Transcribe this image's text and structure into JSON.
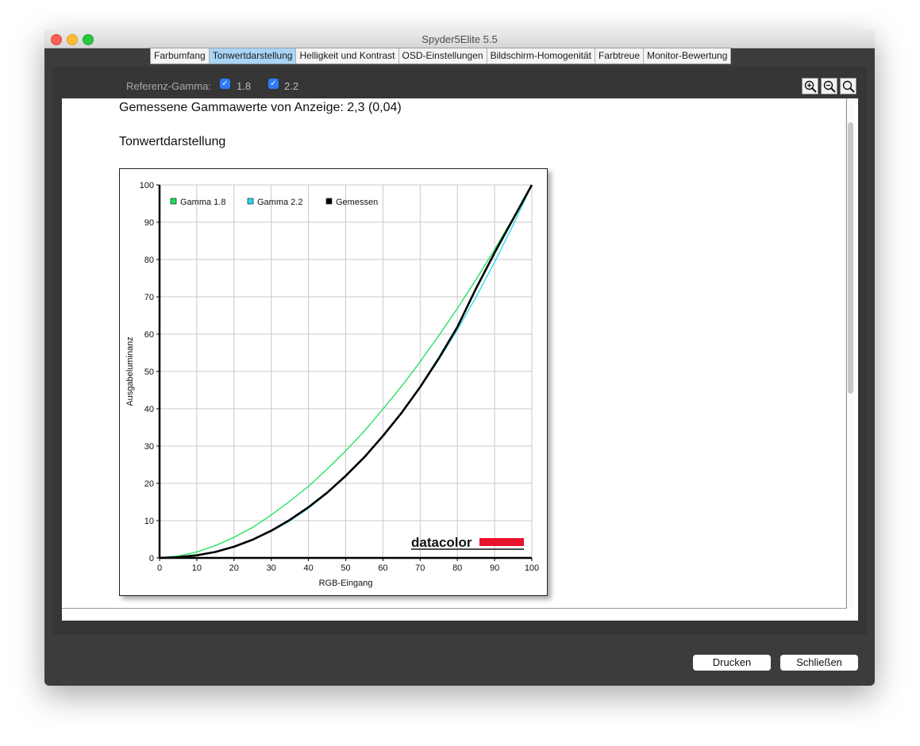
{
  "window": {
    "title": "Spyder5Elite 5.5"
  },
  "tabs": [
    {
      "label": "Farbumfang",
      "active": false
    },
    {
      "label": "Tonwertdarstellung",
      "active": true
    },
    {
      "label": "Helligkeit und Kontrast",
      "active": false
    },
    {
      "label": "OSD-Einstellungen",
      "active": false
    },
    {
      "label": "Bildschirm-Homogenität",
      "active": false
    },
    {
      "label": "Farbtreue",
      "active": false
    },
    {
      "label": "Monitor-Bewertung",
      "active": false
    }
  ],
  "toolbar": {
    "ref_gamma_label": "Referenz-Gamma:",
    "gamma_options": [
      {
        "label": "1.8",
        "checked": true
      },
      {
        "label": "2.2",
        "checked": true
      }
    ],
    "zoom_icons": [
      "zoom-in-icon",
      "zoom-out-icon",
      "zoom-reset-icon"
    ]
  },
  "report": {
    "gamma_measured": "Gemessene Gammawerte von Anzeige: 2,3 (0,04)",
    "section_title": "Tonwertdarstellung",
    "logo_text": "datacolor"
  },
  "buttons": {
    "print": "Drucken",
    "close": "Schließen"
  },
  "chart_data": {
    "type": "line",
    "title": "",
    "xlabel": "RGB-Eingang",
    "ylabel": "Ausgabeluminanz",
    "xlim": [
      0,
      100
    ],
    "ylim": [
      0,
      100
    ],
    "xticks": [
      0,
      10,
      20,
      30,
      40,
      50,
      60,
      70,
      80,
      90,
      100
    ],
    "yticks": [
      0,
      10,
      20,
      30,
      40,
      50,
      60,
      70,
      80,
      90,
      100
    ],
    "grid": true,
    "legend_position": "top-left",
    "x": [
      0,
      5,
      10,
      15,
      20,
      25,
      30,
      35,
      40,
      45,
      50,
      55,
      60,
      65,
      70,
      75,
      80,
      85,
      90,
      95,
      100
    ],
    "series": [
      {
        "name": "Gamma 1.8",
        "color": "#19e05a",
        "values": [
          0,
          0.5,
          1.6,
          3.3,
          5.5,
          8.2,
          11.5,
          15.2,
          19.2,
          23.8,
          28.7,
          34.0,
          39.9,
          46.0,
          52.6,
          59.6,
          66.9,
          74.6,
          82.7,
          91.2,
          100
        ]
      },
      {
        "name": "Gamma 2.2",
        "color": "#22d8ee",
        "values": [
          0,
          0.1,
          0.6,
          1.5,
          2.9,
          4.8,
          7.1,
          9.9,
          13.3,
          17.3,
          21.8,
          26.8,
          32.5,
          38.7,
          45.6,
          53.1,
          61.2,
          69.9,
          79.3,
          89.3,
          100
        ]
      },
      {
        "name": "Gemessen",
        "color": "#000000",
        "values": [
          0,
          0.2,
          0.7,
          1.6,
          3.0,
          4.9,
          7.3,
          10.2,
          13.6,
          17.5,
          22.0,
          27.0,
          32.7,
          38.9,
          45.8,
          53.5,
          61.9,
          72.2,
          81.8,
          90.9,
          100
        ]
      }
    ]
  }
}
